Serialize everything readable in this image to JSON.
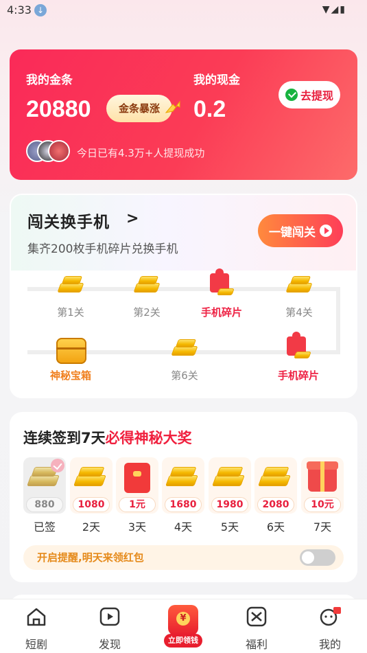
{
  "status_bar": {
    "time": "4:33",
    "download_glyph": "↓",
    "right_glyphs": "▼◢▮"
  },
  "gold_card": {
    "gold_label": "我的金条",
    "gold_value": "20880",
    "surge_label": "金条暴涨",
    "cash_label": "我的现金",
    "cash_value": "0.2",
    "withdraw_label": "去提现",
    "success_text": "今日已有4.3万+人提现成功"
  },
  "challenge": {
    "title": "闯关换手机",
    "arrow": ">",
    "subtitle": "集齐200枚手机碎片兑换手机",
    "button": "一键闯关",
    "stages": [
      {
        "label": "第1关",
        "icon": "gold-bar-icon"
      },
      {
        "label": "第2关",
        "icon": "gold-bar-icon"
      },
      {
        "label": "手机碎片",
        "icon": "puzzle-icon"
      },
      {
        "label": "第4关",
        "icon": "gold-bar-icon"
      },
      {
        "label": "神秘宝箱",
        "icon": "treasure-chest-icon"
      },
      {
        "label": "第6关",
        "icon": "gold-bar-icon"
      },
      {
        "label": "手机碎片",
        "icon": "puzzle-icon"
      }
    ]
  },
  "sign_in": {
    "title_prefix": "连续签到7天",
    "title_highlight": "必得神秘大奖",
    "days": [
      {
        "amount": "880",
        "label": "已签",
        "icon": "gold-bar-icon"
      },
      {
        "amount": "1080",
        "label": "2天",
        "icon": "gold-bar-icon"
      },
      {
        "amount": "1元",
        "label": "3天",
        "icon": "red-envelope-icon"
      },
      {
        "amount": "1680",
        "label": "4天",
        "icon": "gold-bar-icon"
      },
      {
        "amount": "1980",
        "label": "5天",
        "icon": "gold-bar-icon"
      },
      {
        "amount": "2080",
        "label": "6天",
        "icon": "gold-bar-icon"
      },
      {
        "amount": "10元",
        "label": "7天",
        "icon": "gift-box-icon"
      }
    ],
    "reminder": "开启提醒,明天来领红包",
    "reminder_on": false
  },
  "nav": {
    "items": [
      {
        "label": "短剧",
        "icon": "home-icon"
      },
      {
        "label": "发现",
        "icon": "play-icon"
      },
      {
        "label": "立即领钱",
        "icon": "red-envelope-icon"
      },
      {
        "label": "福利",
        "icon": "welfare-icon"
      },
      {
        "label": "我的",
        "icon": "profile-icon"
      }
    ]
  },
  "colors": {
    "accent_red": "#fa2a58",
    "orange": "#f0801f",
    "gold": "#f5b800"
  }
}
